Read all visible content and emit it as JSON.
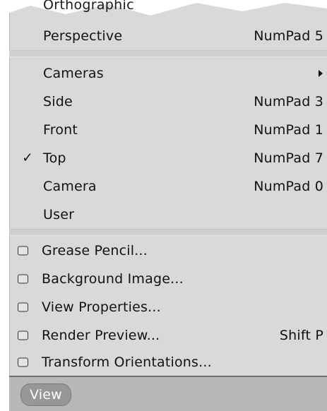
{
  "menu": {
    "cut_label": "Orthographic",
    "perspective": {
      "label": "Perspective",
      "shortcut": "NumPad 5"
    },
    "cameras": {
      "label": "Cameras"
    },
    "side": {
      "label": "Side",
      "shortcut": "NumPad 3"
    },
    "front": {
      "label": "Front",
      "shortcut": "NumPad 1"
    },
    "top": {
      "label": "Top",
      "shortcut": "NumPad 7",
      "checked": true,
      "check_glyph": "✓"
    },
    "camera": {
      "label": "Camera",
      "shortcut": "NumPad 0"
    },
    "user": {
      "label": "User"
    },
    "grease_pencil": {
      "label": "Grease Pencil..."
    },
    "background_image": {
      "label": "Background Image..."
    },
    "view_properties": {
      "label": "View Properties..."
    },
    "render_preview": {
      "label": "Render Preview...",
      "shortcut": "Shift P"
    },
    "transform_orientations": {
      "label": "Transform Orientations..."
    }
  },
  "footer": {
    "view_button": "View"
  },
  "colors": {
    "menu_bg": "#d9d9d9",
    "footer_bg": "#b8b8b8",
    "button_bg": "#979797",
    "text": "#111111"
  }
}
